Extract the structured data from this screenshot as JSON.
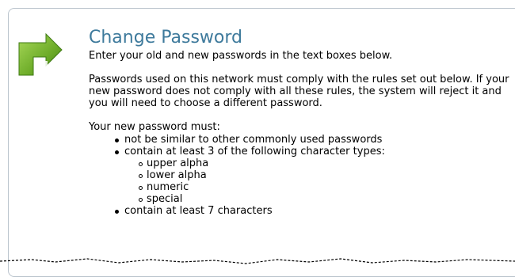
{
  "header": {
    "title": "Change Password",
    "subtitle": "Enter your old and new passwords in the text boxes below."
  },
  "policy": {
    "text": "Passwords used on this network must comply with the rules set out below. If your new password does not comply with all these rules, the system will reject it and you will need to choose a different password."
  },
  "rules": {
    "heading": "Your new password must:",
    "items": [
      "not be similar to other commonly used passwords",
      "contain at least 3 of the following character types:",
      "contain at least 7 characters"
    ],
    "character_types": [
      "upper alpha",
      "lower alpha",
      "numeric",
      "special"
    ]
  },
  "icon": "change-password-arrow-icon",
  "colors": {
    "title": "#3e7a9c",
    "icon_green": "#6cab28",
    "border": "#b9c3cc"
  }
}
